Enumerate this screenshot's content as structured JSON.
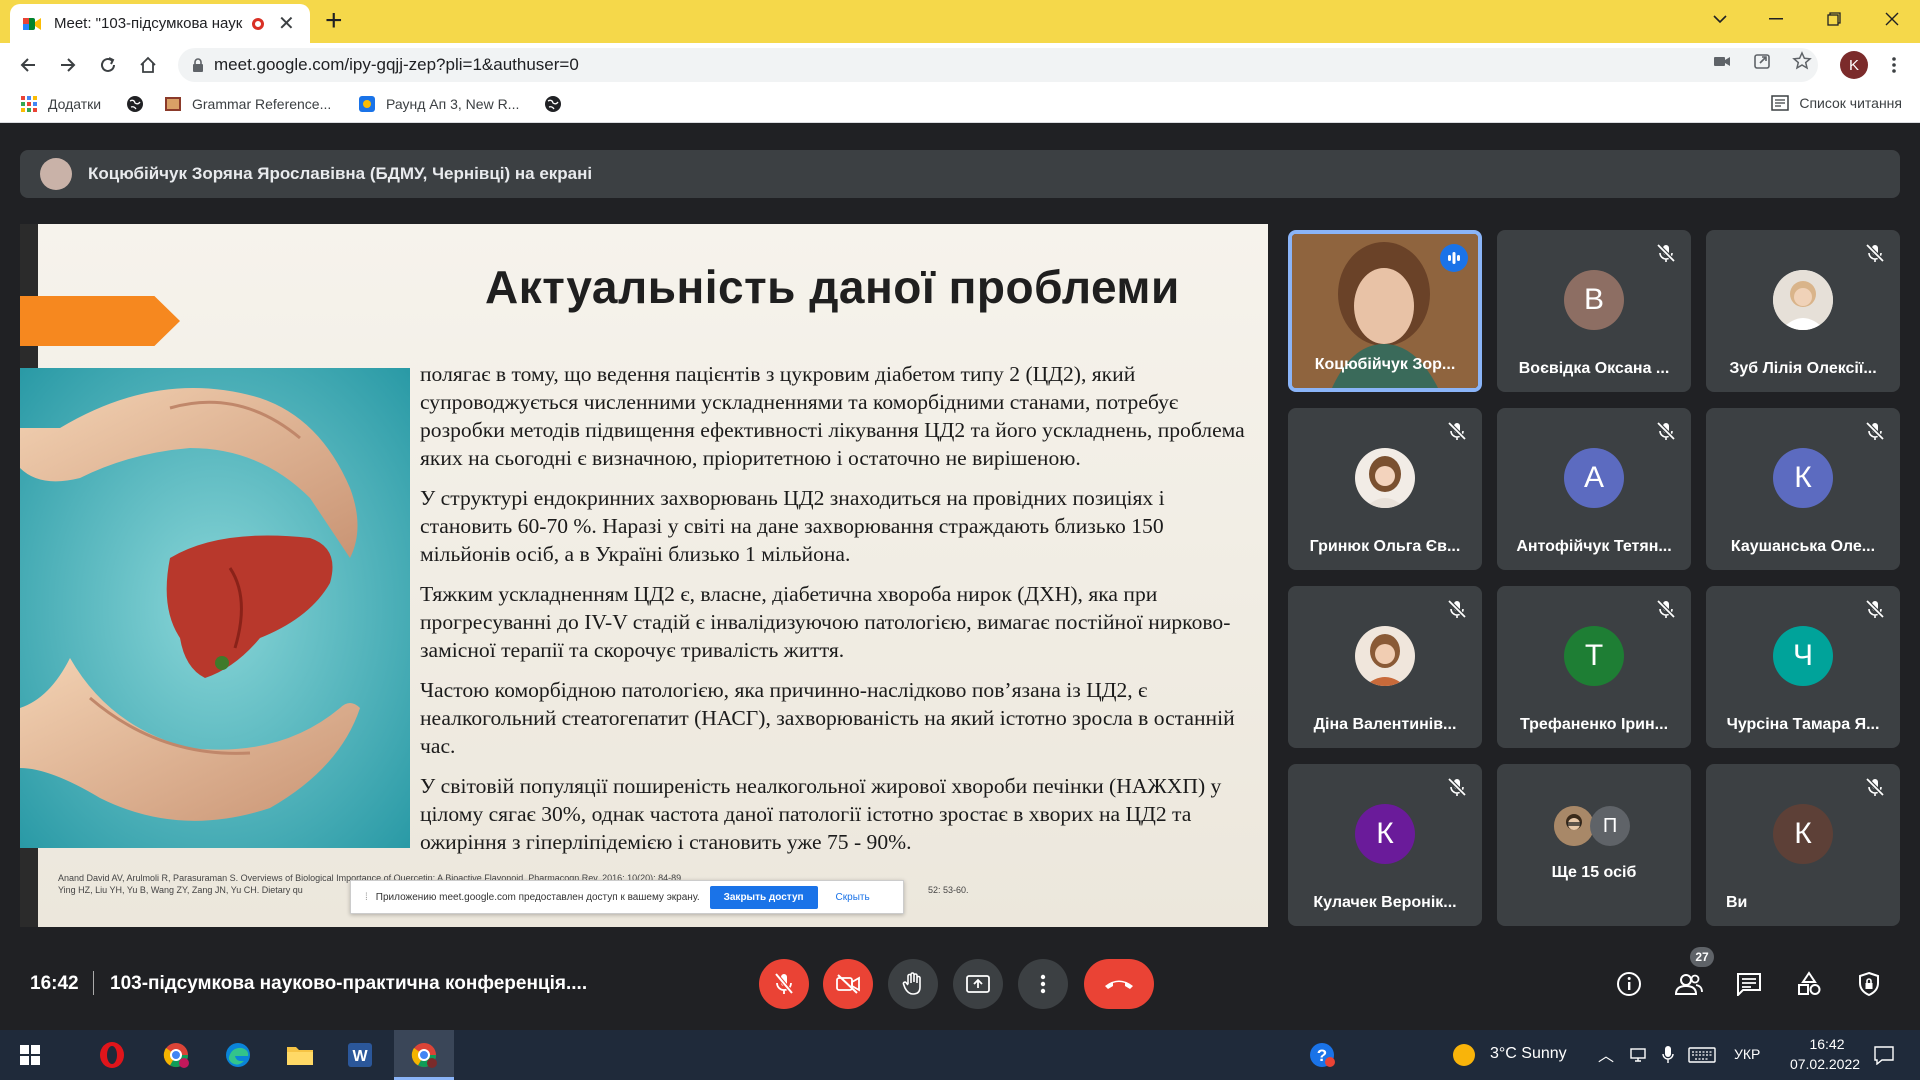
{
  "browser": {
    "tab_title": "Meet: \"103-підсумкова наук",
    "url": "meet.google.com/ipy-gqjj-zep?pli=1&authuser=0",
    "profile_initial": "K",
    "bookmarks": [
      {
        "label": "Додатки",
        "icon": "apps-grid-icon"
      },
      {
        "label": "",
        "icon": "globe-icon"
      },
      {
        "label": "Grammar Reference...",
        "icon": "grammar-book-icon"
      },
      {
        "label": "Раунд Ап 3, New R...",
        "icon": "round-up-icon"
      },
      {
        "label": "",
        "icon": "globe-icon"
      }
    ],
    "reading_list": "Список читання",
    "colors": {
      "tabstrip": "#f5d84a"
    }
  },
  "meet": {
    "presenter_banner": "Коцюбійчук Зоряна Ярославівна (БДМУ, Чернівці) на екрані",
    "slide": {
      "title": "Актуальність даної проблеми",
      "paragraphs": [
        "полягає в тому, що ведення пацієнтів з цукровим діабетом типу 2 (ЦД2), який супроводжується численними ускладненнями та коморбідними станами, потребує розробки методів підвищення ефективності лікування ЦД2 та його ускладнень, проблема яких на сьогодні є визначною, пріоритетною і остаточно не вирішеною.",
        "У структурі ендокринних захворювань ЦД2 знаходиться на провідних позиціях і становить 60-70 %. Наразі у світі на дане захворювання страждають близько 150 мільйонів осіб, а в Україні близько 1 мільйона.",
        "Тяжким ускладненням ЦД2 є, власне, діабетична хвороба нирок (ДХН), яка при прогресуванні до IV-V стадій є інвалідизуючою патологією, вимагає постійної нирково-замісної терапії та скорочує тривалість життя.",
        "Частою коморбідною патологією, яка причинно-наслідково пов’язана із ЦД2, є неалкогольний стеатогепатит (НАСГ), захворюваність на який істотно зросла в останній час.",
        "У світовій популяції поширеність неалкогольної жирової хвороби печінки (НАЖХП) у цілому сягає 30%, однак частота даної патології істотно зростає в хворих на ЦД2 та ожиріння з гіперліпідемією і становить уже 75 - 90%."
      ],
      "reference_1": "Anand David AV, Arulmoli R, Parasuraman S. Overviews of Biological Importance of Quercetin: A Bioactive Flavonoid. Pharmacogn Rev. 2016; 10(20): 84-89.",
      "reference_2": "Ying HZ, Liu YH, Yu B, Wang ZY, Zang JN, Yu CH. Dietary qu",
      "reference_2_tail": "52: 53-60.",
      "share_notice": {
        "text": "Приложению meet.google.com предоставлен доступ к вашему экрану.",
        "stop_button": "Закрыть доступ",
        "hide_link": "Скрыть"
      }
    },
    "participants": [
      {
        "name": "Коцюбійчук Зор...",
        "initial": "",
        "color": "",
        "kind": "video",
        "speaking": true
      },
      {
        "name": "Воєвідка Оксана ...",
        "initial": "В",
        "color": "#8d6e63",
        "kind": "letter"
      },
      {
        "name": "Зуб Лілія Олексії...",
        "initial": "",
        "color": "#cfd8dc",
        "kind": "photo"
      },
      {
        "name": "Гринюк Ольга Єв...",
        "initial": "",
        "color": "#e0c0a8",
        "kind": "photo"
      },
      {
        "name": "Антофійчук Тетян...",
        "initial": "А",
        "color": "#5c6bc0",
        "kind": "letter"
      },
      {
        "name": "Каушанська Оле...",
        "initial": "К",
        "color": "#5c6bc0",
        "kind": "letter"
      },
      {
        "name": "Діна Валентинів...",
        "initial": "",
        "color": "#d7a88a",
        "kind": "photo"
      },
      {
        "name": "Трефаненко Ірин...",
        "initial": "Т",
        "color": "#1e7e34",
        "kind": "letter"
      },
      {
        "name": "Чурсіна Тамара Я...",
        "initial": "Ч",
        "color": "#00a39a",
        "kind": "letter"
      },
      {
        "name": "Кулачек Веронік...",
        "initial": "К",
        "color": "#6a1b9a",
        "kind": "letter"
      },
      {
        "name": "Ще 15 осіб",
        "initial": "П",
        "color": "#5f6368",
        "kind": "more"
      },
      {
        "name": "Ви",
        "initial": "К",
        "color": "#5d4037",
        "kind": "self"
      }
    ],
    "bottom": {
      "time": "16:42",
      "meeting_title": "103-підсумкова науково-практична конференція....",
      "participant_count": "27"
    }
  },
  "taskbar": {
    "weather": "3°C  Sunny",
    "language": "УКР",
    "time": "16:42",
    "date": "07.02.2022"
  }
}
